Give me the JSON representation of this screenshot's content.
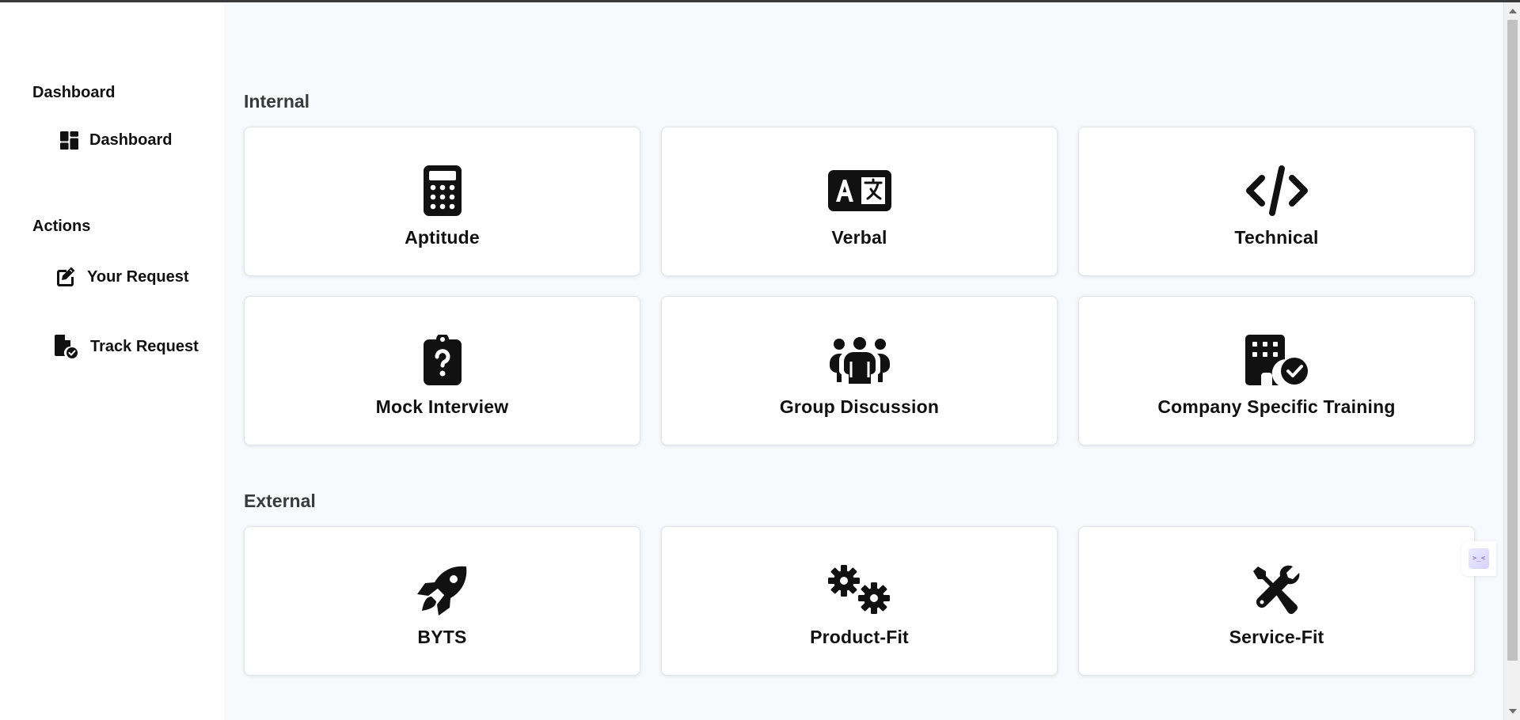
{
  "sidebar": {
    "sections": [
      {
        "title": "Dashboard",
        "items": [
          {
            "label": "Dashboard",
            "icon": "dashboard-icon"
          }
        ]
      },
      {
        "title": "Actions",
        "items": [
          {
            "label": "Your Request",
            "icon": "edit-icon"
          },
          {
            "label": "Track Request",
            "icon": "file-check-icon"
          }
        ]
      }
    ]
  },
  "main": {
    "sections": [
      {
        "title": "Internal",
        "cards": [
          {
            "label": "Aptitude",
            "icon": "calculator-icon"
          },
          {
            "label": "Verbal",
            "icon": "language-icon"
          },
          {
            "label": "Technical",
            "icon": "code-icon"
          },
          {
            "label": "Mock Interview",
            "icon": "clipboard-question-icon"
          },
          {
            "label": "Group Discussion",
            "icon": "people-group-icon"
          },
          {
            "label": "Company Specific Training",
            "icon": "building-check-icon"
          }
        ]
      },
      {
        "title": "External",
        "cards": [
          {
            "label": "BYTS",
            "icon": "rocket-icon"
          },
          {
            "label": "Product-Fit",
            "icon": "gears-icon"
          },
          {
            "label": "Service-Fit",
            "icon": "screwdriver-wrench-icon"
          }
        ]
      }
    ]
  },
  "widget": {
    "text": ">_<"
  },
  "colors": {
    "page_background": "#f8f9fc",
    "sidebar_background": "#ffffff",
    "card_background": "#ffffff",
    "text": "#111111",
    "section_title": "#3a3a3a"
  }
}
